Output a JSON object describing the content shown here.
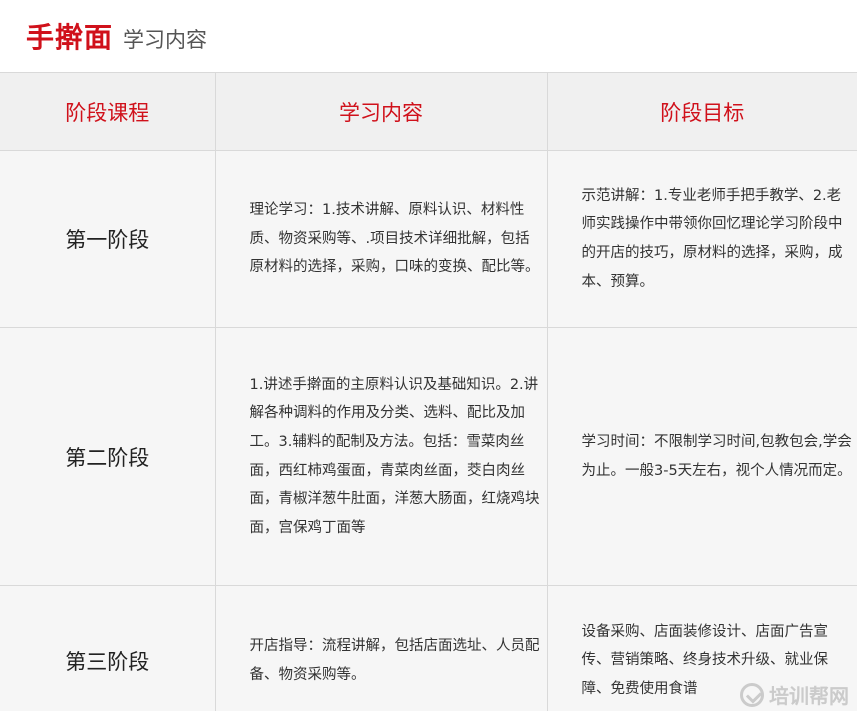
{
  "header": {
    "title_main": "手擀面",
    "title_sub": "学习内容"
  },
  "table": {
    "columns": [
      "阶段课程",
      "学习内容",
      "阶段目标"
    ],
    "rows": [
      {
        "stage": "第一阶段",
        "content": "理论学习：1.技术讲解、原料认识、材料性质、物资采购等、.项目技术详细批解，包括原材料的选择，采购，口味的变换、配比等。",
        "goal": "示范讲解：1.专业老师手把手教学、2.老师实践操作中带领你回忆理论学习阶段中的开店的技巧，原材料的选择，采购，成本、预算。"
      },
      {
        "stage": "第二阶段",
        "content": "1.讲述手擀面的主原料认识及基础知识。2.讲解各种调料的作用及分类、选料、配比及加工。3.辅料的配制及方法。包括：雪菜肉丝面，西红柿鸡蛋面，青菜肉丝面，茭白肉丝面，青椒洋葱牛肚面，洋葱大肠面，红烧鸡块面，宫保鸡丁面等",
        "goal": "学习时间：不限制学习时间,包教包会,学会为止。一般3-5天左右，视个人情况而定。"
      },
      {
        "stage": "第三阶段",
        "content": "开店指导：流程讲解，包括店面选址、人员配备、物资采购等。",
        "goal": "设备采购、店面装修设计、店面广告宣传、营销策略、终身技术升级、就业保障、免费使用食谱"
      }
    ]
  },
  "watermark": {
    "text": "培训帮网"
  }
}
